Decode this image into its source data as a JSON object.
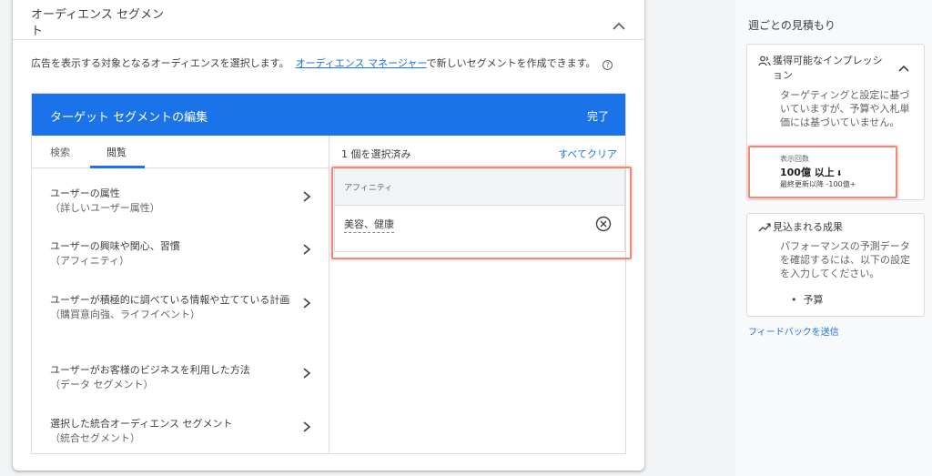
{
  "section": {
    "title": "オーディエンス セグメント",
    "description_prefix": "広告を表示する対象となるオーディエンスを選択します。",
    "manager_link": "オーディエンス マネージャー",
    "description_suffix": "で新しいセグメントを作成できます。",
    "help_icon": "?"
  },
  "editor": {
    "title": "ターゲット セグメントの編集",
    "done_label": "完了",
    "tabs": [
      {
        "label": "検索",
        "active": false
      },
      {
        "label": "閲覧",
        "active": true
      }
    ],
    "categories": [
      {
        "label": "ユーザーの属性",
        "sub": "（詳しいユーザー属性）"
      },
      {
        "label": "ユーザーの興味や関心、習慣",
        "sub": "（アフィニティ）"
      },
      {
        "label": "ユーザーが積極的に調べている情報や立てている計画",
        "sub": "（購買意向強、ライフイベント）"
      },
      {
        "label": "ユーザーがお客様のビジネスを利用した方法",
        "sub": "（データ セグメント）"
      },
      {
        "label": "選択した統合オーディエンス セグメント",
        "sub": "（統合セグメント）"
      }
    ],
    "selected_count": "1 個を選択済み",
    "clear_all": "すべてクリア",
    "selected_group": "アフィニティ",
    "selected_item": "美容、健康"
  },
  "sidebar": {
    "title": "週ごとの見積もり",
    "impressions_card": {
      "title": "獲得可能なインプレッション",
      "note": "ターゲティングと設定に基づいていますが、予算や入札単価には基づいていません。",
      "label": "表示回数",
      "value": "100億 以上",
      "trend_arrow": "⬇",
      "delta": "最終更新以降 -100億+"
    },
    "results_card": {
      "title": "見込まれる成果",
      "note": "パフォーマンスの予測データを確認するには、以下の設定を入力してください。",
      "bullet": "予算"
    },
    "feedback": "フィードバックを送信"
  },
  "colors": {
    "accent": "#1a73e8",
    "highlight": "#ee8a7c"
  }
}
